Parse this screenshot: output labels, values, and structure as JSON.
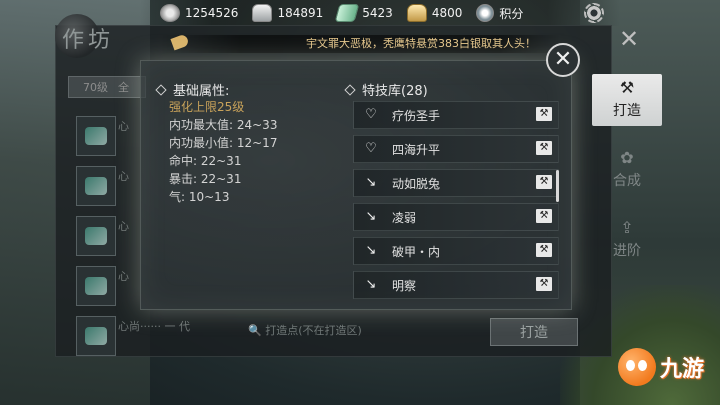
{
  "currencies": [
    {
      "icon": "coin-icon",
      "value": "1254526"
    },
    {
      "icon": "silver-ingot-icon",
      "value": "184891"
    },
    {
      "icon": "jade-ticket-icon",
      "value": "5423"
    },
    {
      "icon": "gold-ingot-icon",
      "value": "4800"
    },
    {
      "icon": "points-icon",
      "value": "积分"
    }
  ],
  "background_window": {
    "title": "作坊",
    "filter_level": "70级",
    "filter_all": "全",
    "list_items": [
      "心",
      "心",
      "心",
      "心",
      "心尚"
    ],
    "list_item_last_suffix": "······ 一 代",
    "search_placeholder": "打造点(不在打造区)",
    "craft_button": "打造"
  },
  "tabs": [
    {
      "label": "打造",
      "icon": "anvil-icon",
      "active": true
    },
    {
      "label": "合成",
      "icon": "merge-icon",
      "active": false
    },
    {
      "label": "进阶",
      "icon": "advance-icon",
      "active": false
    }
  ],
  "announcement": "宇文罪大恶极，秃鹰特悬赏383白银取其人头！",
  "popup": {
    "base_section_title": "基础属性:",
    "attributes": {
      "enhance_cap": "强化上限25级",
      "inner_max": "内功最大值: 24~33",
      "inner_min": "内功最小值: 12~17",
      "hit": "命中: 22~31",
      "crit": "暴击: 22~31",
      "qi": "气: 10~13"
    },
    "skill_section_title": "特技库(28)",
    "skills": [
      {
        "name": "疗伤圣手",
        "icon": "heart-icon"
      },
      {
        "name": "四海升平",
        "icon": "heart-icon"
      },
      {
        "name": "动如脱兔",
        "icon": "sword-icon"
      },
      {
        "name": "凌弱",
        "icon": "sword-icon"
      },
      {
        "name": "破甲・内",
        "icon": "sword-icon"
      },
      {
        "name": "明察",
        "icon": "sword-icon"
      }
    ]
  },
  "logo": {
    "text": "九游"
  }
}
